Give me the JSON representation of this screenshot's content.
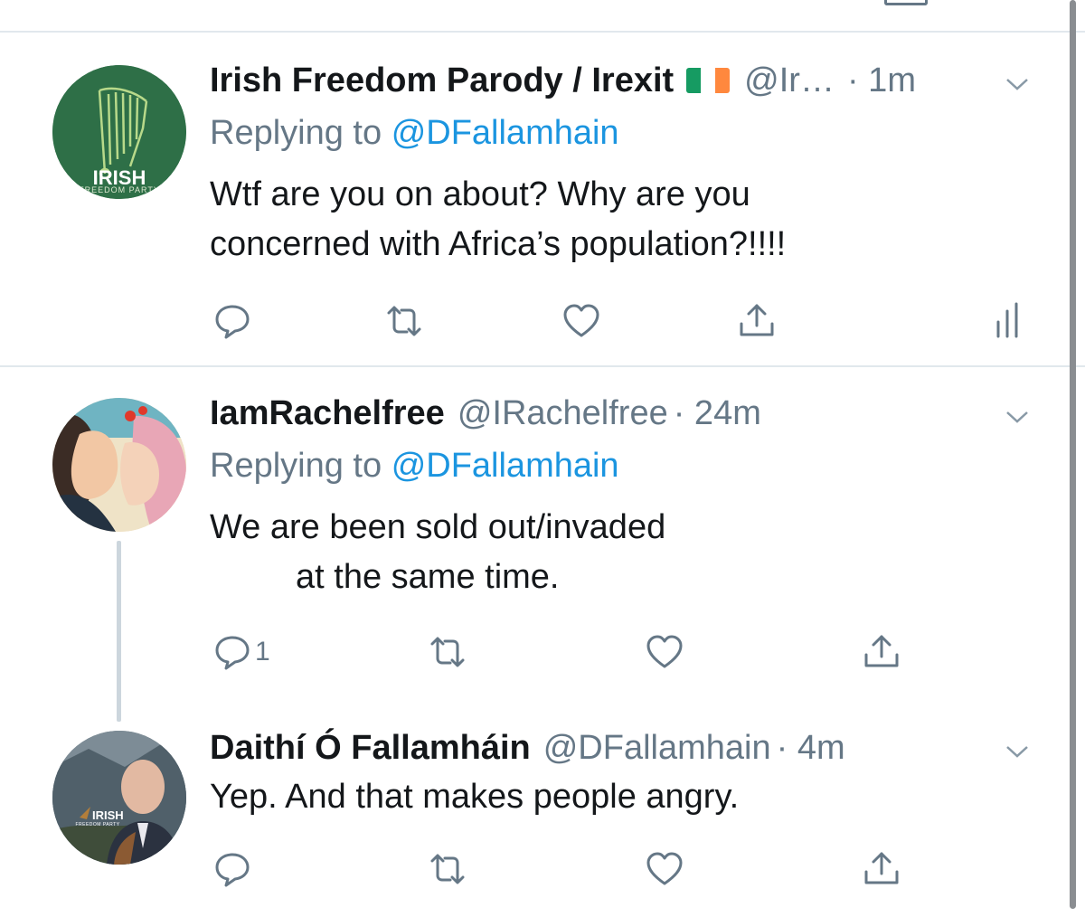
{
  "colors": {
    "text": "#14171a",
    "secondary": "#657786",
    "link": "#1b95e0",
    "divider": "#e1e8ed",
    "thread_line": "#ccd6dd",
    "flag": [
      "#169b62",
      "#ffffff",
      "#ff883e"
    ]
  },
  "tweets": [
    {
      "name": "Irish Freedom Parody / Irexit",
      "flag_icon": "flag-ireland-icon",
      "handle": "@Ir…",
      "time": "· 1m",
      "replying_label": "Replying to",
      "replying_to": "@DFallamhain",
      "text": "Wtf are you on about? Why are you\nconcerned with Africa’s population?!!!!",
      "avatar_text": "IRISH",
      "avatar_subtext": "FREEDOM PARTY",
      "reply_count": ""
    },
    {
      "name": "IamRachelfree",
      "handle": "@IRachelfree",
      "time": "· 24m",
      "replying_label": "Replying to",
      "replying_to": "@DFallamhain",
      "text": "We are been sold out/invaded\n         at the same time.",
      "reply_count": "1"
    },
    {
      "name": "Daithí Ó Fallamháin",
      "handle": "@DFallamhain",
      "time": "· 4m",
      "text": "Yep. And that makes people angry.",
      "avatar_text": "IRISH",
      "avatar_subtext": "FREEDOM PARTY",
      "reply_count": ""
    }
  ]
}
